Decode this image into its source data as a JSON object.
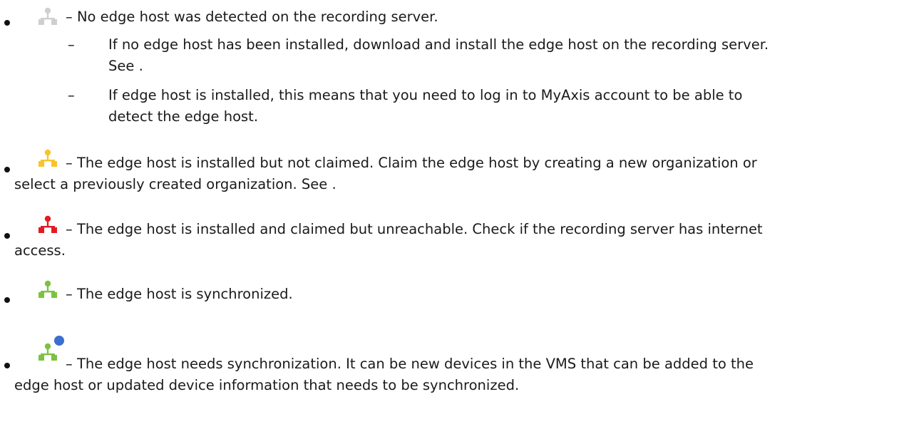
{
  "items": [
    {
      "icon": "network-host-icon",
      "status": "gray",
      "color": "#cfcfcf",
      "text": "– No edge host was detected on the recording server.",
      "subitems": [
        {
          "dash": "–",
          "line1": "If no edge host has been installed, download and install the edge host on the recording server.",
          "line2": "See ."
        },
        {
          "dash": "–",
          "line1": "If edge host is installed, this means that you need to log in to MyAxis account to be able to",
          "line2": "detect the edge host."
        }
      ]
    },
    {
      "icon": "network-host-icon",
      "status": "yellow",
      "color": "#f7c52a",
      "line1": "– The edge host is installed but not claimed. Claim the edge host by creating a new organization or",
      "line2": "select a previously created organization. See ."
    },
    {
      "icon": "network-host-icon",
      "status": "red",
      "color": "#e21b23",
      "line1": "– The edge host is installed and claimed but unreachable. Check if the recording server has internet",
      "line2": "access."
    },
    {
      "icon": "network-host-icon",
      "status": "green",
      "color": "#7cc242",
      "line1": "– The edge host is synchronized."
    },
    {
      "icon": "network-host-sync-icon",
      "status": "green-with-blue-dot",
      "color": "#7cc242",
      "badge_color": "#3a6fd0",
      "line1": "– The edge host needs synchronization. It can be new devices in the VMS that can be added to the",
      "line2": "edge host or updated device information that needs to be synchronized."
    }
  ]
}
